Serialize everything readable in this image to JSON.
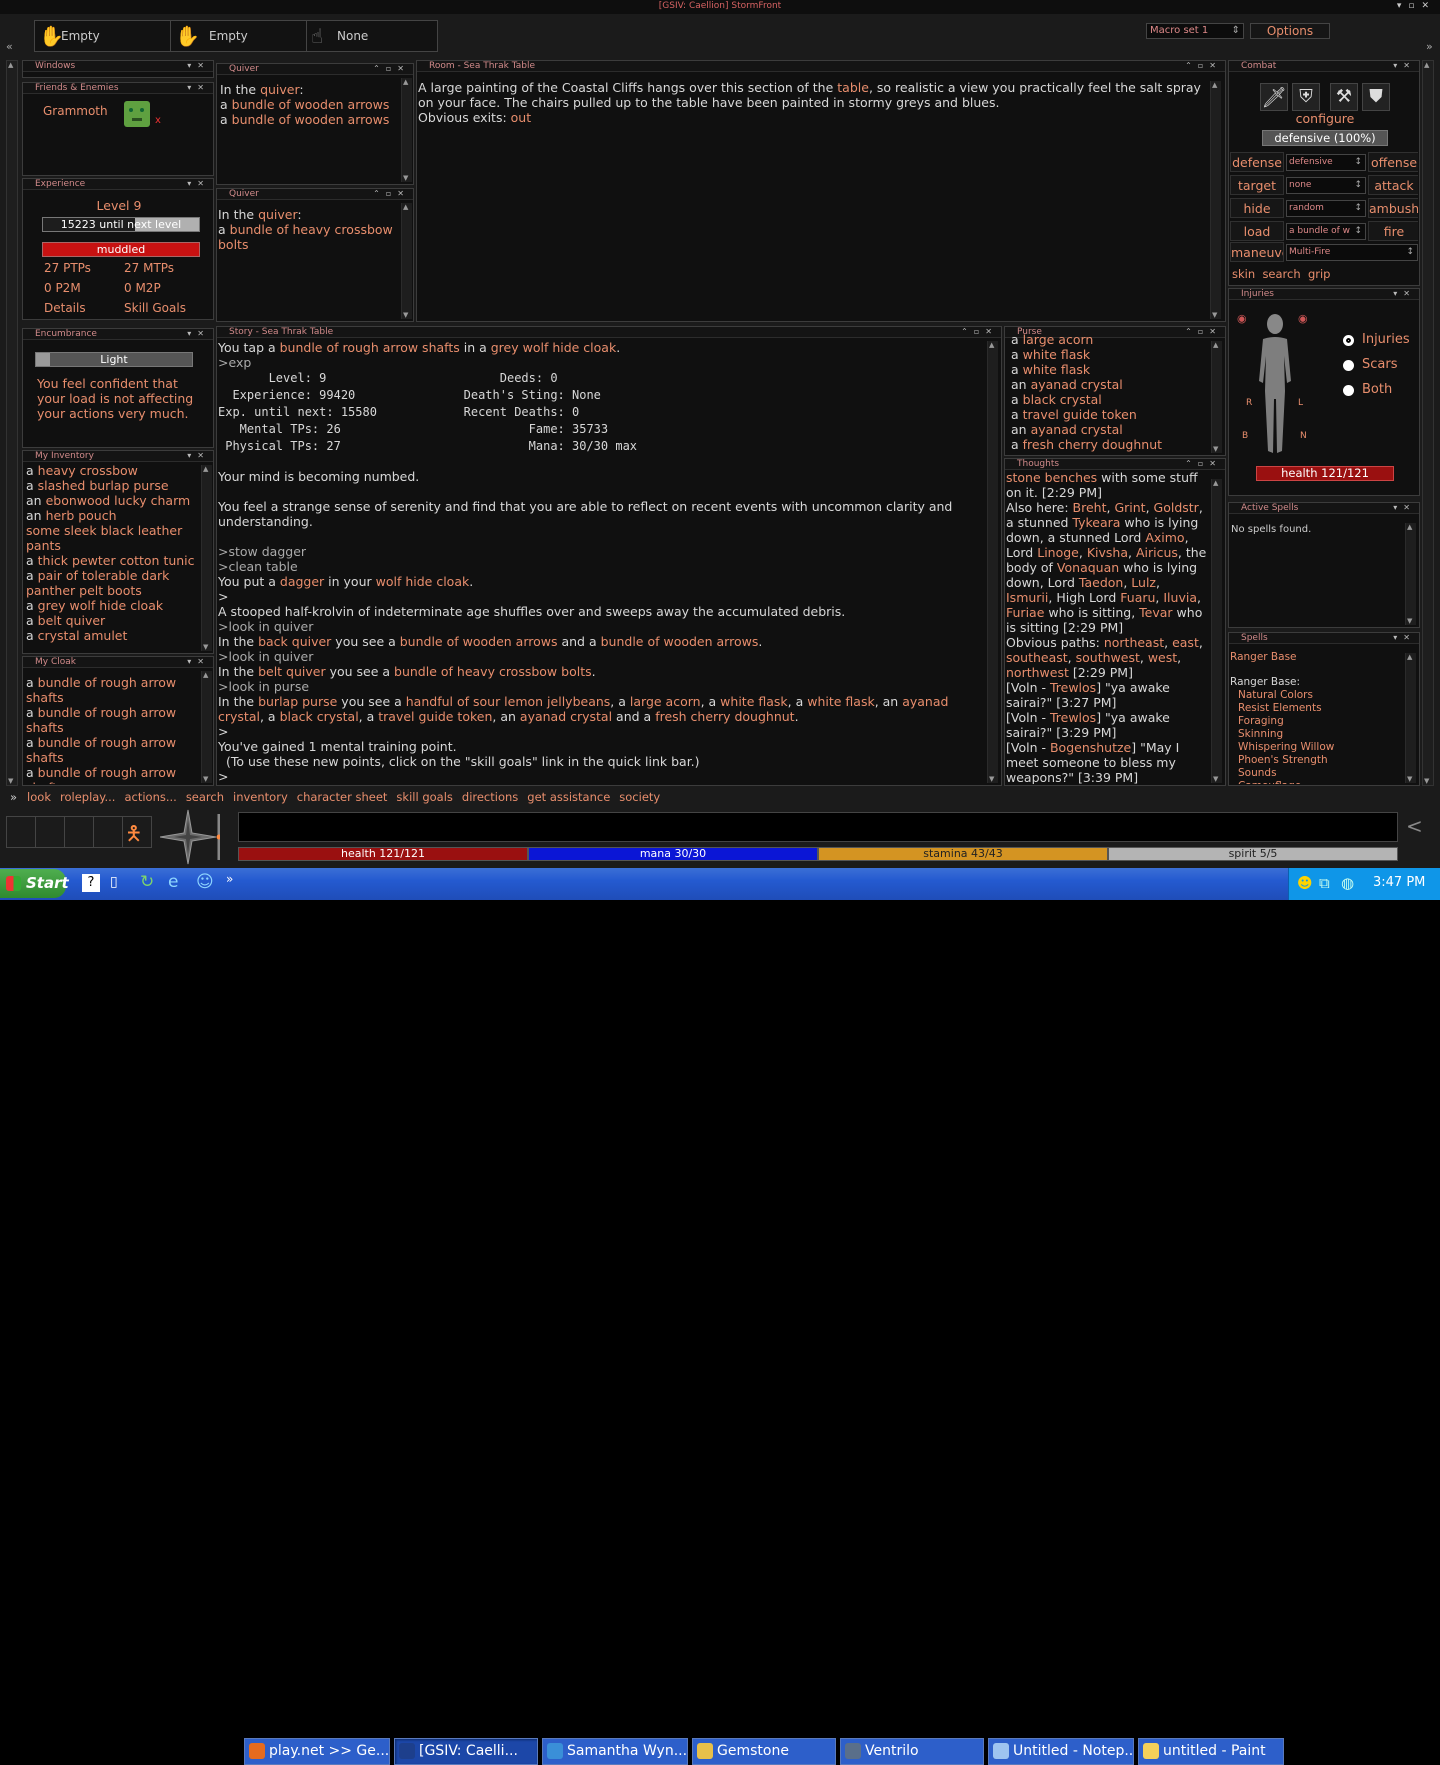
{
  "window": {
    "title": "[GSIV: Caellion] StormFront"
  },
  "hands": {
    "left": "Empty",
    "right": "Empty",
    "spell": "None"
  },
  "macro": {
    "set": "Macro set 1",
    "options": "Options"
  },
  "panels": {
    "windows": {
      "title": "Windows"
    },
    "friends": {
      "title": "Friends & Enemies",
      "name": "Grammoth",
      "remove": "x"
    },
    "experience": {
      "title": "Experience",
      "level": "Level 9",
      "next": "15223 until next level",
      "mind": "muddled",
      "ptps": "27 PTPs",
      "mtps": "27 MTPs",
      "p2m": "0 P2M",
      "m2p": "0 M2P",
      "details": "Details",
      "skillgoals": "Skill Goals"
    },
    "encumbrance": {
      "title": "Encumbrance",
      "level": "Light",
      "text": "You feel confident that your load is not affecting your actions very much."
    },
    "inventory": {
      "title": "My Inventory",
      "items": [
        {
          "pre": "a ",
          "name": "heavy crossbow"
        },
        {
          "pre": "a ",
          "name": "slashed burlap purse"
        },
        {
          "pre": "an ",
          "name": "ebonwood lucky charm"
        },
        {
          "pre": "an ",
          "name": "herb pouch"
        },
        {
          "pre": " ",
          "name": "some sleek black leather pants"
        },
        {
          "pre": "a ",
          "name": "thick pewter cotton tunic"
        },
        {
          "pre": "a ",
          "name": "pair of tolerable dark panther pelt boots"
        },
        {
          "pre": "a ",
          "name": "grey wolf hide cloak"
        },
        {
          "pre": "a ",
          "name": "belt quiver"
        },
        {
          "pre": "a ",
          "name": "crystal amulet"
        }
      ]
    },
    "cloak": {
      "title": "My Cloak",
      "items": [
        "bundle of rough arrow shafts",
        "bundle of rough arrow shafts",
        "bundle of rough arrow shafts",
        "bundle of rough arrow shafts"
      ]
    },
    "quiver1": {
      "title": "Quiver",
      "intro": "In the ",
      "container": "quiver",
      "colon": ":",
      "items": [
        "bundle of wooden arrows",
        "bundle of wooden arrows"
      ]
    },
    "quiver2": {
      "title": "Quiver",
      "intro": "In the ",
      "container": "quiver",
      "colon": ":",
      "items": [
        "bundle of heavy crossbow bolts"
      ]
    },
    "room": {
      "title": "Room - Sea Thrak Table",
      "line1a": "A large painting of the Coastal Cliffs hangs over this section of the ",
      "line1link": "table",
      "line1b": ", so realistic a view you practically feel the salt spray on your face.  The chairs pulled up to the table have been painted in stormy greys and blues.",
      "exits": "Obvious exits: ",
      "exit1": "out"
    },
    "story": {
      "title": "Story - Sea Thrak Table"
    },
    "purse": {
      "title": "Purse",
      "items": [
        {
          "pre": "a ",
          "name": "large acorn"
        },
        {
          "pre": "a ",
          "name": "white flask"
        },
        {
          "pre": "a ",
          "name": "white flask"
        },
        {
          "pre": "an ",
          "name": "ayanad crystal"
        },
        {
          "pre": "a ",
          "name": "black crystal"
        },
        {
          "pre": "a ",
          "name": "travel guide token"
        },
        {
          "pre": "an ",
          "name": "ayanad crystal"
        },
        {
          "pre": "a ",
          "name": "fresh cherry doughnut"
        }
      ]
    },
    "thoughts": {
      "title": "Thoughts"
    },
    "combat": {
      "title": "Combat",
      "configure": "configure",
      "stance": "defensive (100%)",
      "rows": [
        {
          "left": "defense",
          "sel": "defensive",
          "right": "offense"
        },
        {
          "left": "target",
          "sel": "none",
          "right": "attack"
        },
        {
          "left": "hide",
          "sel": "random",
          "right": "ambush"
        },
        {
          "left": "load",
          "sel": "a bundle of w",
          "right": "fire"
        }
      ],
      "maneuve": "maneuve",
      "maneuve_sel": "Multi-Fire",
      "links": "skin  search  grip"
    },
    "injuries": {
      "title": "Injuries",
      "opt1": "Injuries",
      "opt2": "Scars",
      "opt3": "Both",
      "health": "health 121/121",
      "lbl_r": "R",
      "lbl_l": "L",
      "lbl_b": "B",
      "lbl_n": "N"
    },
    "active_spells": {
      "title": "Active Spells",
      "text": "No spells found."
    },
    "spells": {
      "title": "Spells",
      "group": "Ranger Base",
      "group2": "Ranger Base:",
      "items": [
        "Natural Colors",
        "Resist Elements",
        "Foraging",
        "Skinning",
        "Whispering Willow",
        "Phoen's Strength",
        "Sounds",
        "Camouflage"
      ]
    }
  },
  "story_lines": {
    "l0a": "You tap a ",
    "l0b": "bundle of rough arrow shafts",
    "l0c": " in a ",
    "l0d": "grey wolf hide cloak",
    ".l0e": ".",
    "exp_cmd": ">exp",
    "exp_block": "       Level: 9                        Deeds: 0\n  Experience: 99420               Death's Sting: None\nExp. until next: 15580            Recent Deaths: 0\n   Mental TPs: 26                          Fame: 35733\n Physical TPs: 27                          Mana: 30/30 max",
    "numbed": "Your mind is becoming numbed.",
    "serenity": "You feel a strange sense of serenity and find that you are able to reflect on recent events with uncommon clarity and understanding.",
    "stow": ">stow dagger",
    "clean": ">clean table",
    "put_a": "You put a ",
    "put_b": "dagger",
    "put_c": " in your ",
    "put_d": "wolf hide cloak",
    "put_e": ".",
    "prompt": ">",
    "krolvin": "A stooped half-krolvin of indeterminate age shuffles over and sweeps away the accumulated debris.",
    "lq1": ">look in quiver",
    "bq_a": "In the ",
    "bq_b": "back quiver",
    "bq_c": " you see a ",
    "bq_d": "bundle of wooden arrows",
    "bq_e": " and a ",
    "bq_f": "bundle of wooden arrows",
    "bq_g": ".",
    "lq2": ">look in quiver",
    "blq_a": "In the ",
    "blq_b": "belt quiver",
    "blq_c": " you see a ",
    "blq_d": "bundle of heavy crossbow bolts",
    "blq_e": ".",
    "lp": ">look in purse",
    "pu_a": "In the ",
    "pu_b": "burlap purse",
    "pu_c": " you see a ",
    "pu_d": "handful of sour lemon jellybeans",
    "pu_e": ", a ",
    "pu_f": "large acorn",
    "pu_g": ", a ",
    "pu_h": "white flask",
    "pu_i": ", a ",
    "pu_j": "white flask",
    "pu_k": ", an ",
    "pu_l": "ayanad crystal",
    "pu_m": ", a ",
    "pu_n": "black crystal",
    "pu_o": ", a ",
    "pu_p": "travel guide token",
    "pu_q": ", an ",
    "pu_r": "ayanad crystal",
    "pu_s": " and a ",
    "pu_t": "fresh cherry doughnut",
    "pu_u": ".",
    "gained": "You've gained 1 mental training point.",
    "gained2": "  (To use these new points, click on the \"skill goals\" link in the quick link bar.)"
  },
  "thoughts_lines": {
    "t0a": "stone benches",
    "t0b": " with some stuff on it. [2:29 PM]",
    "t1": "Also here: ",
    "n1": "Breht",
    "c1": ", ",
    "n2": "Grint",
    "c2": ", ",
    "n3": "Goldstr",
    "c3": ",",
    "t2": "a stunned ",
    "n4": "Tykeara",
    "t3": " who is lying down, a stunned Lord ",
    "n5": "Aximo",
    "c5": ",",
    "t4": "Lord ",
    "n6": "Linoge",
    "c6": ", ",
    "n7": "Kivsha",
    "c7": ", ",
    "n8": "Airicus",
    "t5": ", the body of ",
    "n9": "Vonaquan",
    "t6": " who is lying down, Lord ",
    "n10": "Taedon",
    "c10": ", ",
    "n11": "Lulz",
    "c11": ",",
    "n12": "Ismurii",
    "t7": ", High Lord ",
    "n13": "Fuaru",
    "c13": ", ",
    "n14": "Iluvia",
    "c14": ",",
    "n15": "Furiae",
    "t8": " who is sitting, ",
    "n16": "Tevar",
    "t9": " who is sitting [2:29 PM]",
    "p0": "Obvious paths: ",
    "p1": "northeast",
    "pc1": ", ",
    "p2": "east",
    "pc2": ",",
    "p3": "southeast",
    "pc3": ", ",
    "p4": "southwest",
    "pc4": ", ",
    "p5": "west",
    "pc5": ",",
    "p6": "northwest",
    "p7": " [2:29 PM]",
    "v1a": "[Voln - ",
    "v1b": "Trewlos",
    "v1c": "] \"ya awake sairai?\" [3:27 PM]",
    "v2a": "[Voln - ",
    "v2b": "Trewlos",
    "v2c": "] \"ya awake sairai?\" [3:29 PM]",
    "v3a": "[Voln - ",
    "v3b": "Bogenshutze",
    "v3c": "] \"May I meet someone to bless my weapons?\" [3:39 PM]"
  },
  "links": [
    "look",
    "roleplay...",
    "actions...",
    "search",
    "inventory",
    "character sheet",
    "skill goals",
    "directions",
    "get assistance",
    "society"
  ],
  "links_prefix": "»",
  "vitals": {
    "health": "health 121/121",
    "mana": "mana 30/30",
    "stamina": "stamina 43/43",
    "spirit": "spirit 5/5"
  },
  "bars": {
    "health": 1.0,
    "mana": 1.0,
    "stamina": 1.0,
    "spirit": 1.0
  },
  "colors": {
    "link": "#e88e6d",
    "health": "#9a1010",
    "mana": "#0b16d6",
    "stamina": "#d49422",
    "spirit": "#b4b4b4"
  },
  "taskbar": {
    "start": "Start",
    "clock": "3:47 PM",
    "tasks": [
      "play.net >> Ge...",
      "[GSIV: Caelli...",
      "Samantha Wyn...",
      "Gemstone",
      "Ventrilo",
      "Untitled - Notep...",
      "untitled - Paint"
    ]
  }
}
